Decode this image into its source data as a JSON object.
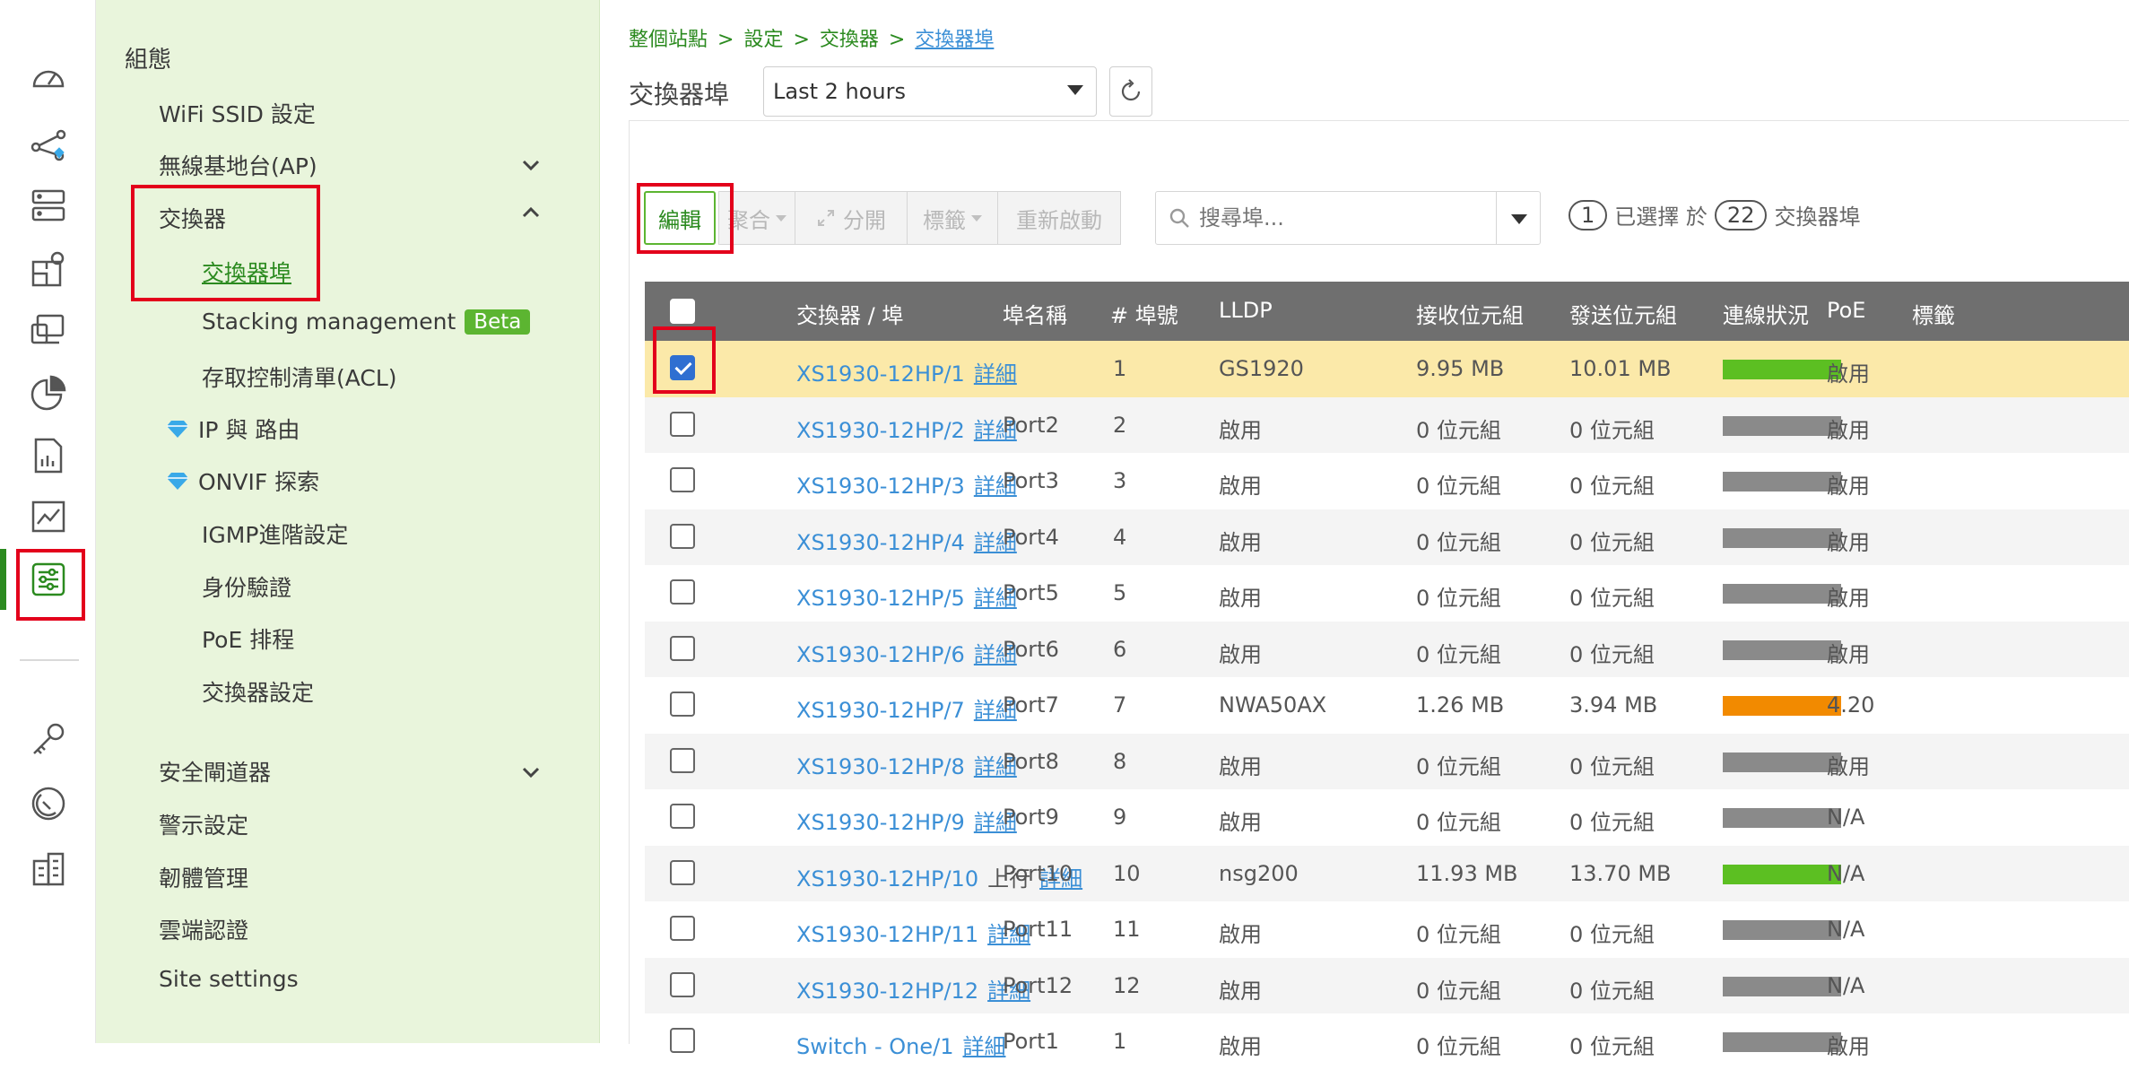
{
  "rail": {
    "icons": [
      "dashboard-icon",
      "topology-icon",
      "devices-icon",
      "floorplan-icon",
      "clients-icon",
      "analytics-icon",
      "report-icon",
      "trend-icon",
      "configure-icon",
      "license-icon",
      "support-icon",
      "organization-icon"
    ]
  },
  "menu": {
    "heading": "組態",
    "items": [
      {
        "label": "WiFi SSID 設定"
      },
      {
        "label": "無線基地台(AP)"
      },
      {
        "label": "交換器"
      },
      {
        "label": "交換器埠"
      },
      {
        "label": "Stacking management",
        "badge": "Beta"
      },
      {
        "label": "存取控制清單(ACL)"
      },
      {
        "label": "IP 與 路由"
      },
      {
        "label": "ONVIF 探索"
      },
      {
        "label": "IGMP進階設定"
      },
      {
        "label": "身份驗證"
      },
      {
        "label": "PoE 排程"
      },
      {
        "label": "交換器設定"
      },
      {
        "label": "安全閘道器"
      },
      {
        "label": "警示設定"
      },
      {
        "label": "韌體管理"
      },
      {
        "label": "雲端認證"
      },
      {
        "label": "Site settings"
      }
    ]
  },
  "breadcrumb": {
    "level1": "整個站點",
    "level2": "設定",
    "level3": "交換器",
    "current": "交換器埠",
    "separator": ">"
  },
  "page": {
    "title": "交換器埠",
    "range": "Last 2 hours"
  },
  "toolbar": {
    "edit": "編輯",
    "aggregate": "聚合",
    "split": "分開",
    "tag": "標籤",
    "restart": "重新啟動"
  },
  "search": {
    "placeholder": "搜尋埠..."
  },
  "selection": {
    "selected": "1",
    "text_selected": "已選擇 於",
    "total": "22",
    "text_ports": "交換器埠"
  },
  "table": {
    "headers": {
      "port": "交換器 / 埠",
      "name": "埠名稱",
      "number": "# 埠號",
      "lldp": "LLDP",
      "rx": "接收位元組",
      "tx": "發送位元組",
      "status": "連線狀況",
      "poe": "PoE",
      "tag": "標籤"
    },
    "detail_label": "詳細",
    "uplink_label": "上行",
    "status_colors": {
      "connected": "#5cbf22",
      "poe": "#f28a00",
      "disconnected": "#8a8a8a"
    },
    "rows": [
      {
        "port": "XS1930-12HP/1",
        "name": "",
        "number": "1",
        "lldp": "GS1920",
        "rx": "9.95 MB",
        "tx": "10.01 MB",
        "status": "connected",
        "poe": "啟用",
        "checked": true
      },
      {
        "port": "XS1930-12HP/2",
        "name": "Port2",
        "number": "2",
        "lldp": "啟用",
        "rx": "0 位元組",
        "tx": "0 位元組",
        "status": "disconnected",
        "poe": "啟用"
      },
      {
        "port": "XS1930-12HP/3",
        "name": "Port3",
        "number": "3",
        "lldp": "啟用",
        "rx": "0 位元組",
        "tx": "0 位元組",
        "status": "disconnected",
        "poe": "啟用"
      },
      {
        "port": "XS1930-12HP/4",
        "name": "Port4",
        "number": "4",
        "lldp": "啟用",
        "rx": "0 位元組",
        "tx": "0 位元組",
        "status": "disconnected",
        "poe": "啟用"
      },
      {
        "port": "XS1930-12HP/5",
        "name": "Port5",
        "number": "5",
        "lldp": "啟用",
        "rx": "0 位元組",
        "tx": "0 位元組",
        "status": "disconnected",
        "poe": "啟用"
      },
      {
        "port": "XS1930-12HP/6",
        "name": "Port6",
        "number": "6",
        "lldp": "啟用",
        "rx": "0 位元組",
        "tx": "0 位元組",
        "status": "disconnected",
        "poe": "啟用"
      },
      {
        "port": "XS1930-12HP/7",
        "name": "Port7",
        "number": "7",
        "lldp": "NWA50AX",
        "rx": "1.26 MB",
        "tx": "3.94 MB",
        "status": "poe",
        "poe": "4.20"
      },
      {
        "port": "XS1930-12HP/8",
        "name": "Port8",
        "number": "8",
        "lldp": "啟用",
        "rx": "0 位元組",
        "tx": "0 位元組",
        "status": "disconnected",
        "poe": "啟用"
      },
      {
        "port": "XS1930-12HP/9",
        "name": "Port9",
        "number": "9",
        "lldp": "啟用",
        "rx": "0 位元組",
        "tx": "0 位元組",
        "status": "disconnected",
        "poe": "N/A"
      },
      {
        "port": "XS1930-12HP/10",
        "name": "Port10",
        "number": "10",
        "lldp": "nsg200",
        "rx": "11.93 MB",
        "tx": "13.70 MB",
        "status": "connected",
        "poe": "N/A",
        "uplink": true
      },
      {
        "port": "XS1930-12HP/11",
        "name": "Port11",
        "number": "11",
        "lldp": "啟用",
        "rx": "0 位元組",
        "tx": "0 位元組",
        "status": "disconnected",
        "poe": "N/A"
      },
      {
        "port": "XS1930-12HP/12",
        "name": "Port12",
        "number": "12",
        "lldp": "啟用",
        "rx": "0 位元組",
        "tx": "0 位元組",
        "status": "disconnected",
        "poe": "N/A"
      },
      {
        "port": "Switch - One/1",
        "name": "Port1",
        "number": "1",
        "lldp": "啟用",
        "rx": "0 位元組",
        "tx": "0 位元組",
        "status": "disconnected",
        "poe": "啟用"
      }
    ]
  }
}
